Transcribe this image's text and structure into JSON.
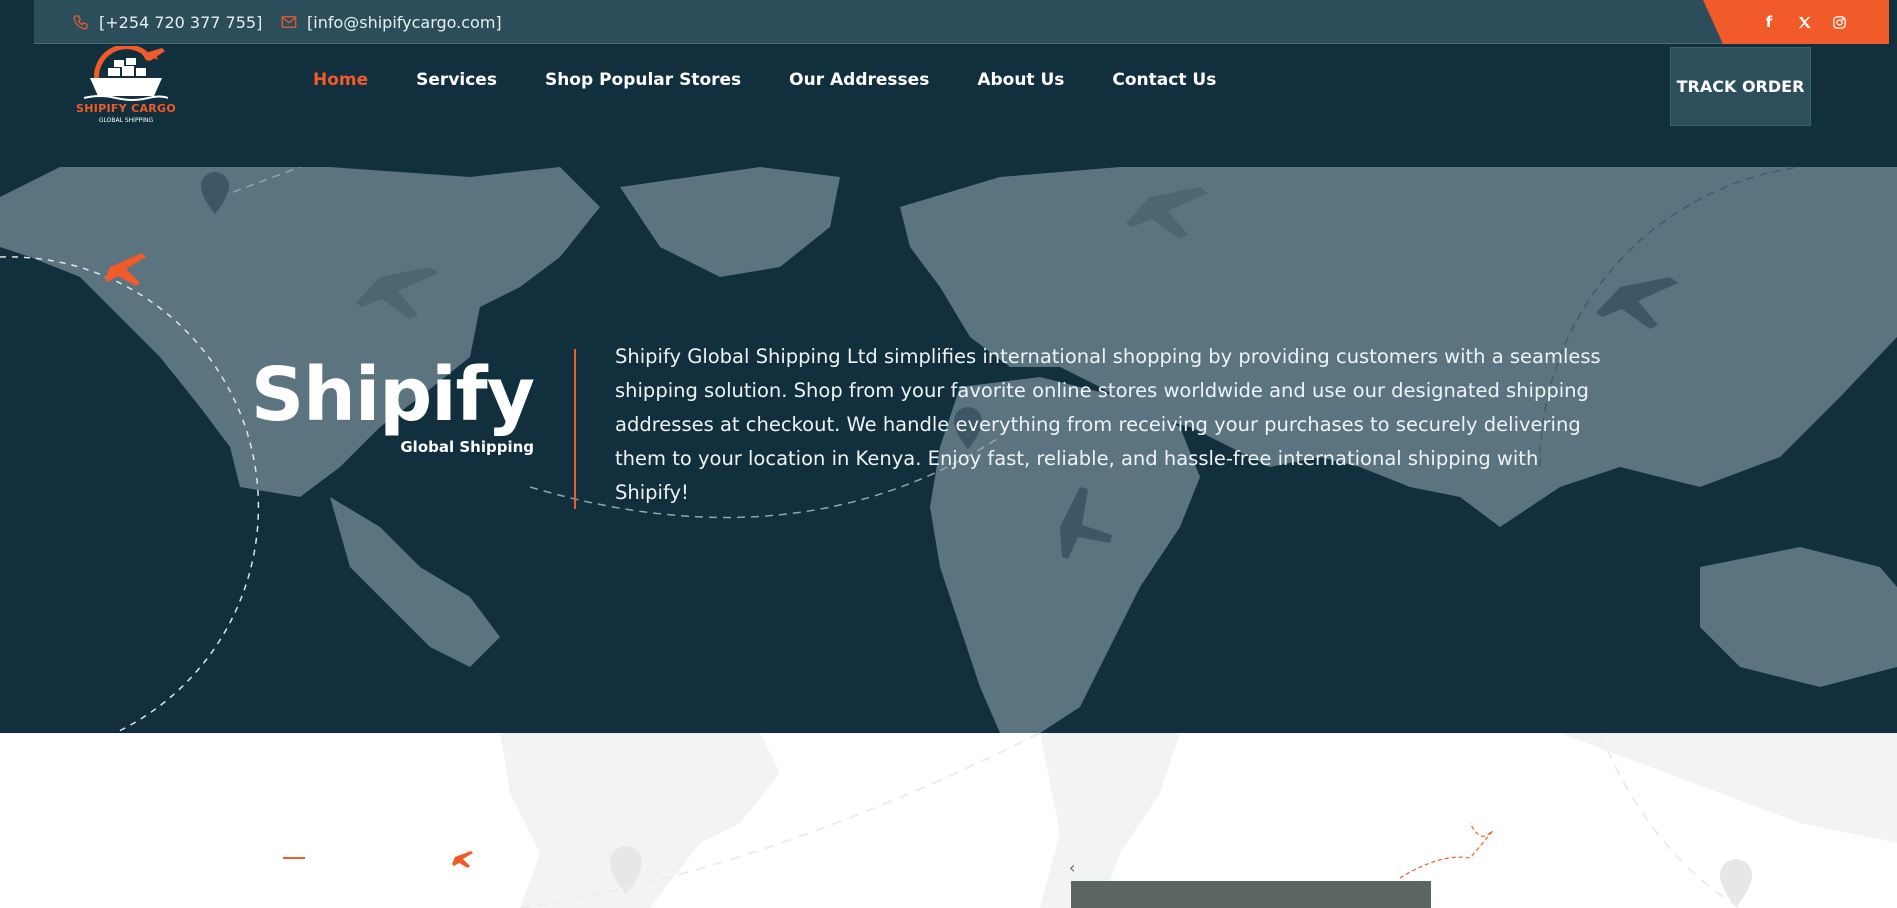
{
  "topbar": {
    "phone": "[+254 720 377 755]",
    "email": "[info@shipifycargo.com]",
    "social": [
      {
        "icon": "facebook-icon",
        "glyph": "f"
      },
      {
        "icon": "x-icon",
        "glyph": "𝕏"
      },
      {
        "icon": "instagram-icon",
        "glyph": ""
      }
    ]
  },
  "logo": {
    "name": "SHIPIFY CARGO",
    "tagline": "GLOBAL SHIPPING"
  },
  "nav": {
    "items": [
      "Home",
      "Services",
      "Shop Popular Stores",
      "Our Addresses",
      "About Us",
      "Contact Us"
    ],
    "active": "Home",
    "track_label": "TRACK ORDER"
  },
  "hero": {
    "title": "Shipify",
    "subtitle": "Global Shipping",
    "description": "Shipify Global Shipping Ltd simplifies international shopping by providing customers with a seamless shipping solution. Shop from your favorite online stores worldwide and use our designated shipping addresses at checkout. We handle everything from receiving your purchases to securely delivering them to your location in Kenya. Enjoy fast, reliable, and hassle-free international shipping with Shipify!"
  },
  "lower": {
    "prev_arrow": "‹"
  },
  "colors": {
    "accent": "#f15a29",
    "navy": "#112f3c",
    "topbar": "#2c4e5b",
    "map": "#5b7480"
  }
}
